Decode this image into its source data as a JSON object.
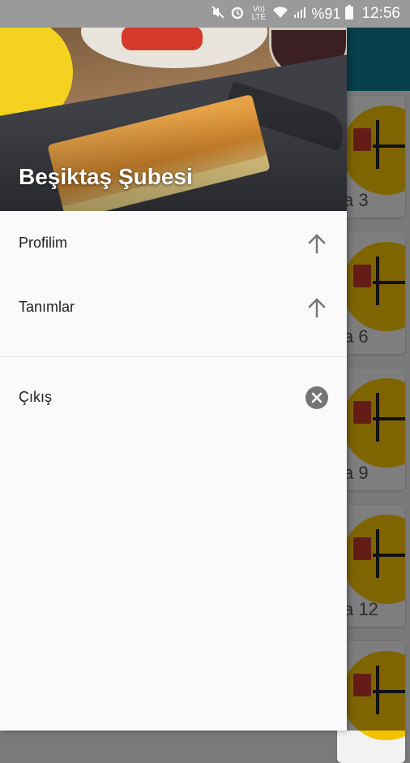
{
  "status_bar": {
    "mute_icon": "mute-icon",
    "alarm_icon": "alarm-icon",
    "volte_text": "Vo) LTE",
    "wifi_icon": "wifi-icon",
    "signal_icon": "signal-icon",
    "battery_percent": "%91",
    "battery_icon": "battery-icon",
    "time": "12:56"
  },
  "background_app": {
    "toolbar_color": "#0b7b93",
    "table_labels": [
      "a 3",
      "a 6",
      "a 9",
      "a 12",
      ""
    ]
  },
  "drawer": {
    "header_title": "Beşiktaş Şubesi",
    "menu": [
      {
        "label": "Profilim",
        "icon": "arrow-up-icon"
      },
      {
        "label": "Tanımlar",
        "icon": "arrow-up-icon"
      }
    ],
    "logout": {
      "label": "Çıkış",
      "icon": "close-circle-icon"
    }
  }
}
